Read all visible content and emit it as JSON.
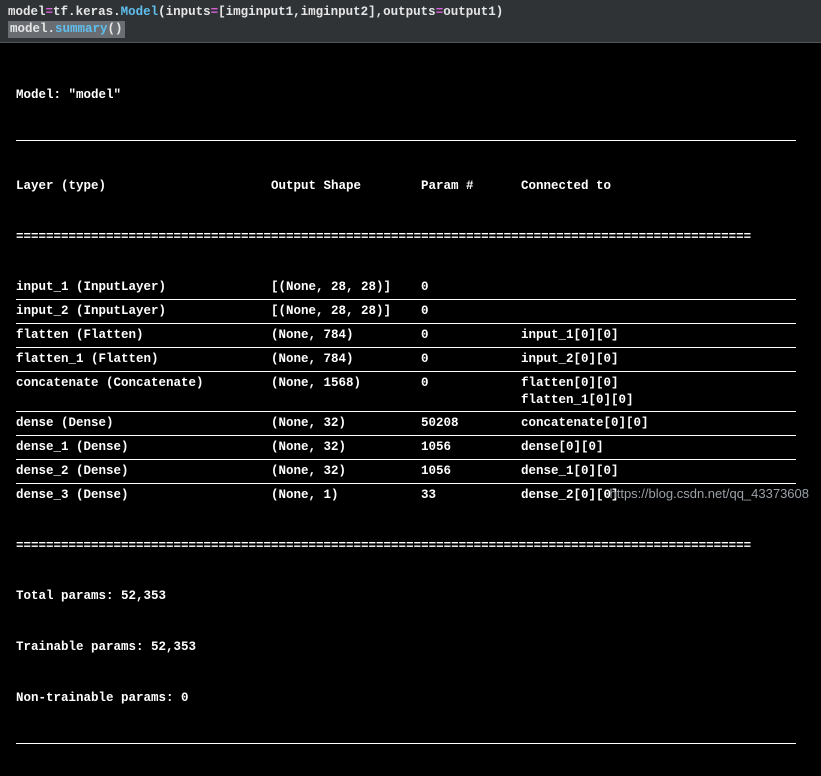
{
  "code": {
    "line1": {
      "v": "model",
      "eq": "=",
      "tf": "tf",
      "keras": "keras",
      "Model": "Model",
      "args": "(inputs",
      "eq2": "=",
      "b1": "[imginput1,imginput2],outputs",
      "eq3": "=",
      "b2": "output1)"
    },
    "line2": {
      "v": "model",
      "dot": ".",
      "fn": "summary",
      "paren": "()"
    }
  },
  "model_name": "Model: \"model\"",
  "headers": {
    "layer": "Layer (type)",
    "shape": "Output Shape",
    "param": "Param #",
    "conn": "Connected to"
  },
  "layers": [
    {
      "name": "input_1 (InputLayer)",
      "shape": "[(None, 28, 28)]",
      "params": "0",
      "conn": []
    },
    {
      "name": "input_2 (InputLayer)",
      "shape": "[(None, 28, 28)]",
      "params": "0",
      "conn": []
    },
    {
      "name": "flatten (Flatten)",
      "shape": "(None, 784)",
      "params": "0",
      "conn": [
        "input_1[0][0]"
      ]
    },
    {
      "name": "flatten_1 (Flatten)",
      "shape": "(None, 784)",
      "params": "0",
      "conn": [
        "input_2[0][0]"
      ]
    },
    {
      "name": "concatenate (Concatenate)",
      "shape": "(None, 1568)",
      "params": "0",
      "conn": [
        "flatten[0][0]",
        "flatten_1[0][0]"
      ]
    },
    {
      "name": "dense (Dense)",
      "shape": "(None, 32)",
      "params": "50208",
      "conn": [
        "concatenate[0][0]"
      ]
    },
    {
      "name": "dense_1 (Dense)",
      "shape": "(None, 32)",
      "params": "1056",
      "conn": [
        "dense[0][0]"
      ]
    },
    {
      "name": "dense_2 (Dense)",
      "shape": "(None, 32)",
      "params": "1056",
      "conn": [
        "dense_1[0][0]"
      ]
    },
    {
      "name": "dense_3 (Dense)",
      "shape": "(None, 1)",
      "params": "33",
      "conn": [
        "dense_2[0][0]"
      ]
    }
  ],
  "totals": {
    "total": "Total params: 52,353",
    "trainable": "Trainable params: 52,353",
    "nontrainable": "Non-trainable params: 0"
  },
  "eq_line": "==================================================================================================",
  "watermark": "https://blog.csdn.net/qq_43373608"
}
